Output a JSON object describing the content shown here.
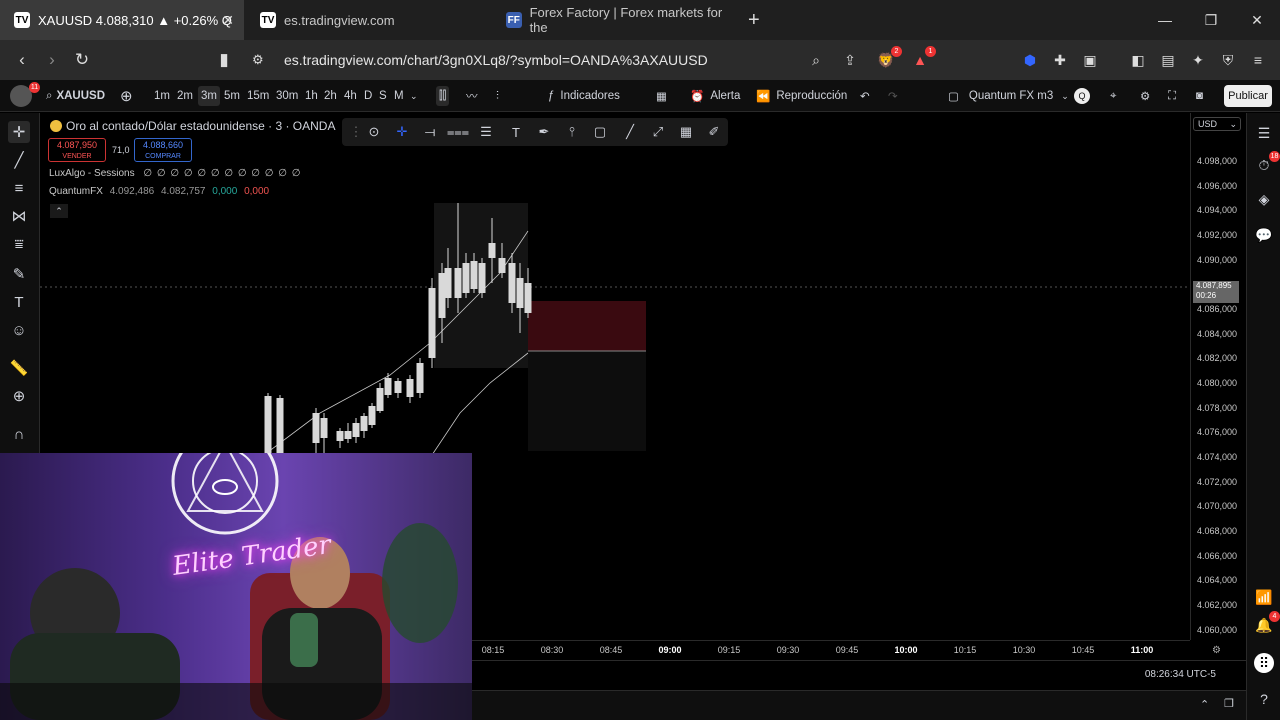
{
  "tabs": [
    {
      "title": "XAUUSD 4.088,310 ▲ +0.26% Q",
      "favicon": "TV",
      "active": true
    },
    {
      "title": "es.tradingview.com",
      "favicon": "TV",
      "active": false
    },
    {
      "title": "Forex Factory | Forex markets for the",
      "favicon": "FF",
      "active": false
    }
  ],
  "address": {
    "url": "es.tradingview.com/chart/3gn0XLq8/?symbol=OANDA%3AXAUUSD"
  },
  "badges": {
    "brave": "2",
    "rewards": "1",
    "profile": "11",
    "right_alerts": "18",
    "notifications": "4"
  },
  "toolbar": {
    "symbol": "XAUUSD",
    "intervals": [
      "1m",
      "2m",
      "3m",
      "5m",
      "15m",
      "30m",
      "1h",
      "2h",
      "4h",
      "D",
      "S",
      "M"
    ],
    "selected_interval": "3m",
    "indicators": "Indicadores",
    "alert": "Alerta",
    "replay": "Reproducción",
    "layout_name": "Quantum FX m3",
    "publish": "Publicar"
  },
  "legend": {
    "title": "Oro al contado/Dólar estadounidense · 3 · OANDA",
    "sell_price": "4.087,950",
    "sell_label": "VENDER",
    "spread": "71,0",
    "buy_price": "4.088,660",
    "buy_label": "COMPRAR",
    "indicator1": "LuxAlgo - Sessions",
    "indicator1_values": "∅ ∅ ∅ ∅ ∅ ∅ ∅ ∅ ∅ ∅ ∅ ∅",
    "indicator2": "QuantumFX",
    "indicator2_v1": "4.092,486",
    "indicator2_v2": "4.082,757",
    "indicator2_v3": "0,000",
    "indicator2_v4": "0,000"
  },
  "price_axis": {
    "currency": "USD",
    "labels": [
      "4.098,000",
      "4.096,000",
      "4.094,000",
      "4.092,000",
      "4.090,000",
      "4.086,000",
      "4.084,000",
      "4.082,000",
      "4.080,000",
      "4.078,000",
      "4.076,000",
      "4.074,000",
      "4.072,000",
      "4.070,000",
      "4.068,000",
      "4.066,000",
      "4.064,000",
      "4.062,000",
      "4.060,000"
    ],
    "current_price": "4.087,895",
    "countdown": "00:26"
  },
  "time_axis": {
    "labels": [
      "08:15",
      "08:30",
      "08:45",
      "09:00",
      "09:15",
      "09:30",
      "09:45",
      "10:00",
      "10:15",
      "10:30",
      "10:45",
      "11:00"
    ],
    "bold": [
      "09:00",
      "10:00",
      "11:00"
    ]
  },
  "clock": "08:26:34 UTC-5",
  "colors": {
    "sell": "#ff5555",
    "buy": "#5588ff",
    "up_candle": "#d9d9d9",
    "zone": "#3a0a10",
    "positive": "#26a69a",
    "negative": "#ef5350"
  },
  "webcam": {
    "logo_text": "Elite Trader"
  }
}
